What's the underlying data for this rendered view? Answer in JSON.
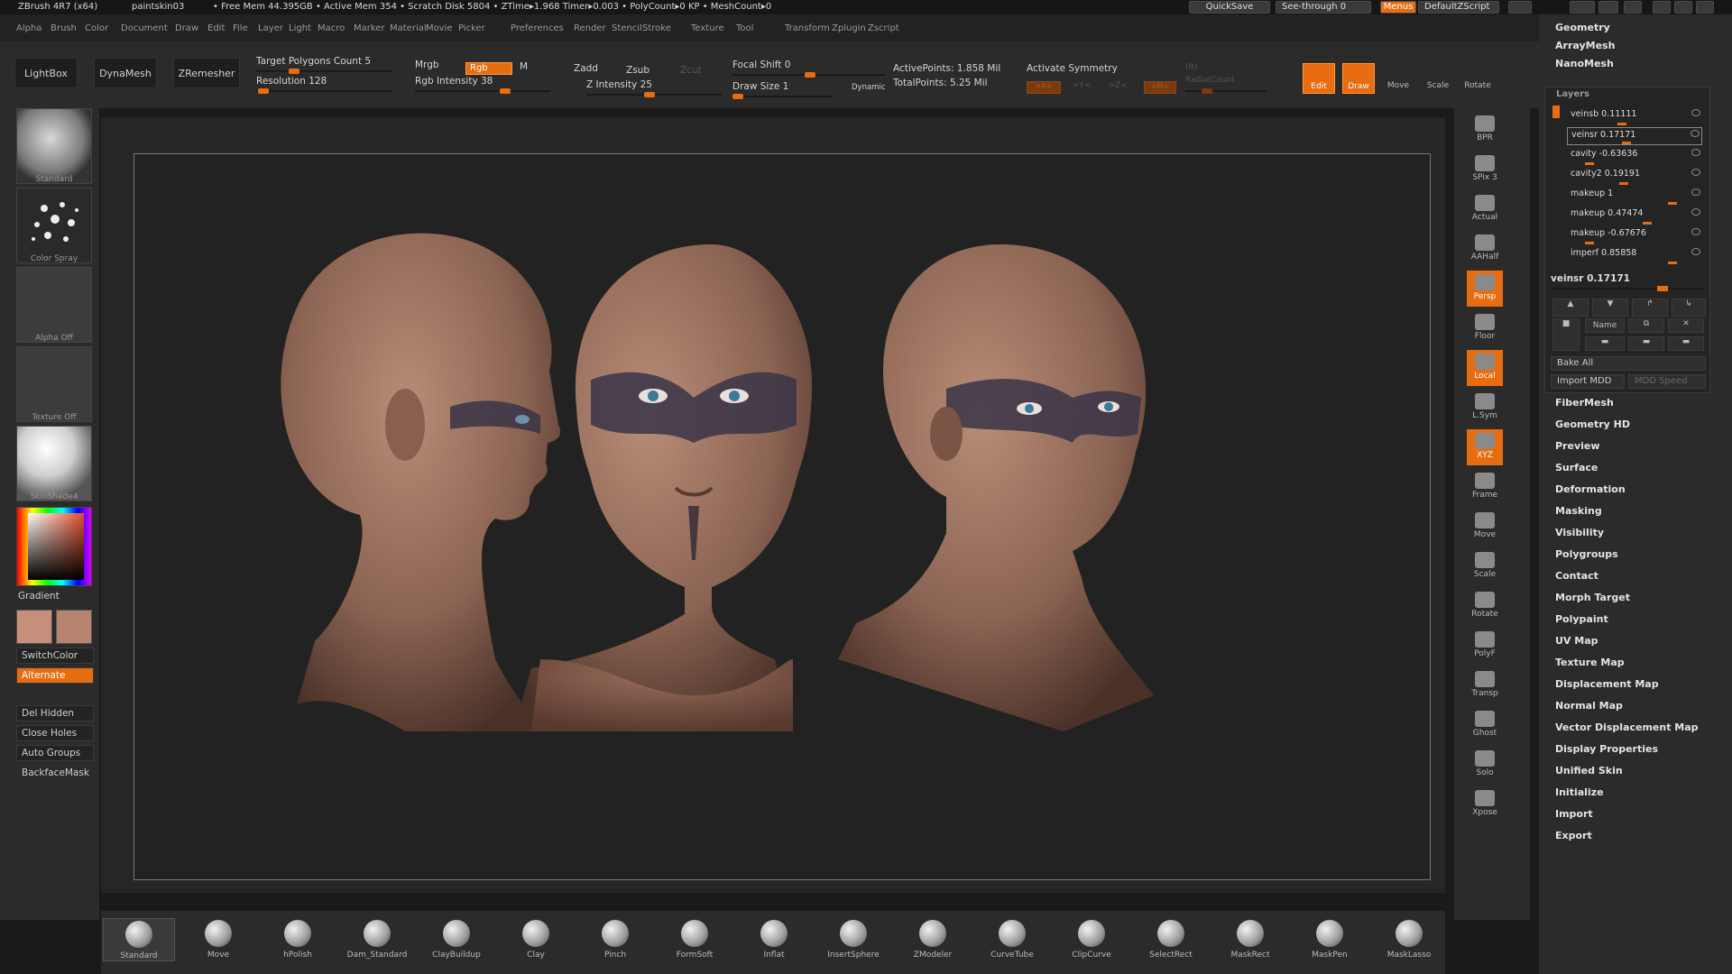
{
  "titlebar": {
    "app": "ZBrush 4R7 (x64)",
    "doc": "paintskin03",
    "status": "• Free Mem 44.395GB • Active Mem 354 • Scratch Disk 5804 • ZTime▸1.968 Timer▸0.003 • PolyCount▸0 KP • MeshCount▸0",
    "quicksave": "QuickSave",
    "seethrough": "See-through   0",
    "menus": "Menus",
    "defaultscript": "DefaultZScript"
  },
  "menubar": [
    "Alpha",
    "Brush",
    "Color",
    "Document",
    "Draw",
    "Edit",
    "File",
    "Layer",
    "Light",
    "Macro",
    "Marker",
    "Material",
    "Movie",
    "Picker",
    "Preferences",
    "Render",
    "Stencil",
    "Stroke",
    "Texture",
    "Tool",
    "Transform",
    "Zplugin",
    "Zscript"
  ],
  "topshelf": {
    "lightbox": "LightBox",
    "dynamesh": "DynaMesh",
    "zremesher": "ZRemesher",
    "target_poly": "Target Polygons Count 5",
    "resolution": "Resolution 128",
    "mrgb": "Mrgb",
    "rgb": "Rgb",
    "m": "M",
    "rgb_intensity": "Rgb Intensity 38",
    "zadd": "Zadd",
    "zsub": "Zsub",
    "zcut": "Zcut",
    "z_intensity": "Z Intensity 25",
    "focal_shift": "Focal Shift 0",
    "draw_size": "Draw Size 1",
    "dynamic": "Dynamic",
    "active_points": "ActivePoints: 1.858  Mil",
    "total_points": "TotalPoints: 5.25  Mil",
    "activate_symmetry": "Activate Symmetry",
    "sym_x": ">X<",
    "sym_y": ">Y<",
    "sym_z": ">Z<",
    "sym_m": ">M<",
    "radial_r": "(R)",
    "radial_count": "RadialCount",
    "edit": "Edit",
    "draw": "Draw",
    "move": "Move",
    "scale": "Scale",
    "rotate": "Rotate"
  },
  "lefttray": {
    "standard": "Standard",
    "color_spray": "Color Spray",
    "alpha_off": "Alpha Off",
    "texture_off": "Texture Off",
    "skinshade": "SkinShade4",
    "gradient": "Gradient",
    "switchcolor": "SwitchColor",
    "alternate": "Alternate",
    "del_hidden": "Del Hidden",
    "close_holes": "Close Holes",
    "auto_groups": "Auto Groups",
    "backfacemask": "BackfaceMask",
    "swatch_main": "#c58f7c",
    "swatch_secondary": "#b7826f"
  },
  "rightshelf": [
    {
      "label": "BPR"
    },
    {
      "label": "SPix 3"
    },
    {
      "label": "Actual"
    },
    {
      "label": "AAHalf"
    },
    {
      "label": "Persp"
    },
    {
      "label": "Floor"
    },
    {
      "label": "Local"
    },
    {
      "label": "L.Sym"
    },
    {
      "label": "XYZ"
    },
    {
      "label": "Frame"
    },
    {
      "label": "Move"
    },
    {
      "label": "Scale"
    },
    {
      "label": "Rotate"
    },
    {
      "label": "PolyF"
    },
    {
      "label": "Transp"
    },
    {
      "label": "Ghost"
    },
    {
      "label": "Solo"
    },
    {
      "label": "Xpose"
    }
  ],
  "palette": {
    "geometry": "Geometry",
    "arraymesh": "ArrayMesh",
    "nanomesh": "NanoMesh",
    "layers_title": "Layers",
    "layers": [
      {
        "name": "veinsb  0.11111"
      },
      {
        "name": "veinsr  0.17171"
      },
      {
        "name": "cavity  -0.63636"
      },
      {
        "name": "cavity2  0.19191"
      },
      {
        "name": "makeup  1"
      },
      {
        "name": "makeup  0.47474"
      },
      {
        "name": "makeup  -0.67676"
      },
      {
        "name": "imperf  0.85858"
      }
    ],
    "current_layer": "veinsr  0.17171",
    "name_btn": "Name",
    "bake_all": "Bake All",
    "import_mdd": "Import MDD",
    "mdd_speed": "MDD Speed",
    "items": [
      "FiberMesh",
      "Geometry HD",
      "Preview",
      "Surface",
      "Deformation",
      "Masking",
      "Visibility",
      "Polygroups",
      "Contact",
      "Morph Target",
      "Polypaint",
      "UV Map",
      "Texture Map",
      "Displacement Map",
      "Normal Map",
      "Vector Displacement Map",
      "Display Properties",
      "Unified Skin",
      "Initialize",
      "Import",
      "Export"
    ]
  },
  "brushes": [
    "Standard",
    "Move",
    "hPolish",
    "Dam_Standard",
    "ClayBuildup",
    "Clay",
    "Pinch",
    "FormSoft",
    "Inflat",
    "InsertSphere",
    "ZModeler",
    "CurveTube",
    "ClipCurve",
    "SelectRect",
    "MaskRect",
    "MaskPen",
    "MaskLasso"
  ]
}
